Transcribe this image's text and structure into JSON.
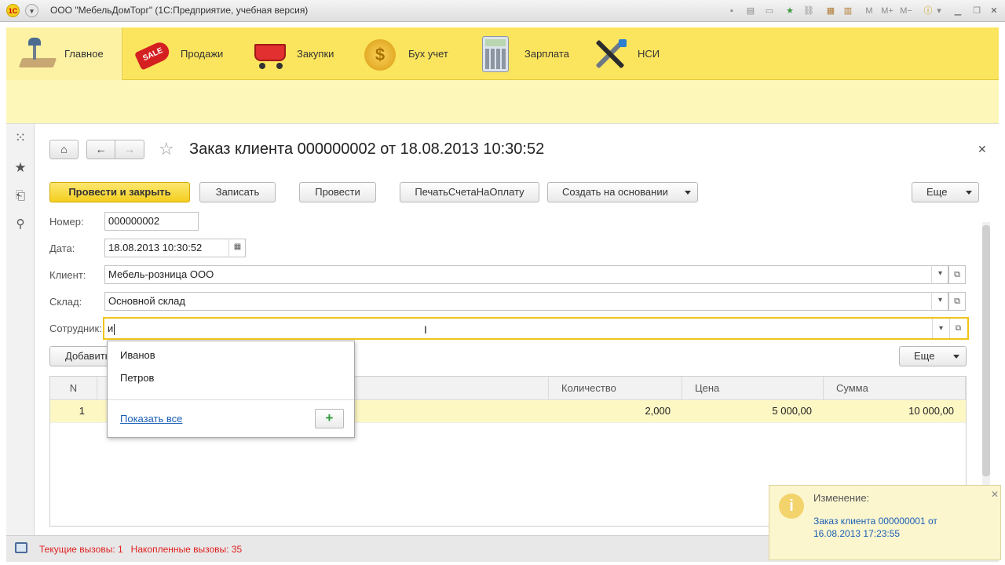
{
  "window": {
    "title": "ООО \"МебельДомТорг\" (1С:Предприятие, учебная версия)"
  },
  "sections": [
    {
      "label": "Главное",
      "icon": "desk-lamp-icon",
      "active": true
    },
    {
      "label": "Продажи",
      "icon": "sale-tag-icon"
    },
    {
      "label": "Закупки",
      "icon": "shopping-cart-icon"
    },
    {
      "label": "Бух учет",
      "icon": "gold-coin-icon"
    },
    {
      "label": "Зарплата",
      "icon": "calculator-icon"
    },
    {
      "label": "НСИ",
      "icon": "tools-icon"
    }
  ],
  "document": {
    "title": "Заказ клиента 000000002 от 18.08.2013 10:30:52"
  },
  "toolbar": {
    "post_close": "Провести и закрыть",
    "save": "Записать",
    "post": "Провести",
    "print_invoice": "ПечатьСчетаНаОплату",
    "create_based": "Создать на основании",
    "more": "Еще"
  },
  "form": {
    "number_label": "Номер:",
    "number_value": "000000002",
    "date_label": "Дата:",
    "date_value": "18.08.2013 10:30:52",
    "client_label": "Клиент:",
    "client_value": "Мебель-розница ООО",
    "warehouse_label": "Склад:",
    "warehouse_value": "Основной склад",
    "employee_label": "Сотрудник:",
    "employee_value": "и"
  },
  "table_toolbar": {
    "add": "Добавить",
    "more": "Еще"
  },
  "table": {
    "columns": [
      "N",
      "Количество",
      "Цена",
      "Сумма"
    ],
    "rows": [
      {
        "n": "1",
        "quantity": "2,000",
        "price": "5 000,00",
        "sum": "10 000,00"
      }
    ]
  },
  "dropdown": {
    "items": [
      "Иванов",
      "Петров"
    ],
    "show_all": "Показать все"
  },
  "status": {
    "text": "Текущие вызовы: 1   Накопленные вызовы: 35"
  },
  "notification": {
    "caption": "Изменение:",
    "link": "Заказ клиента 000000001 от 16.08.2013 17:23:55"
  }
}
